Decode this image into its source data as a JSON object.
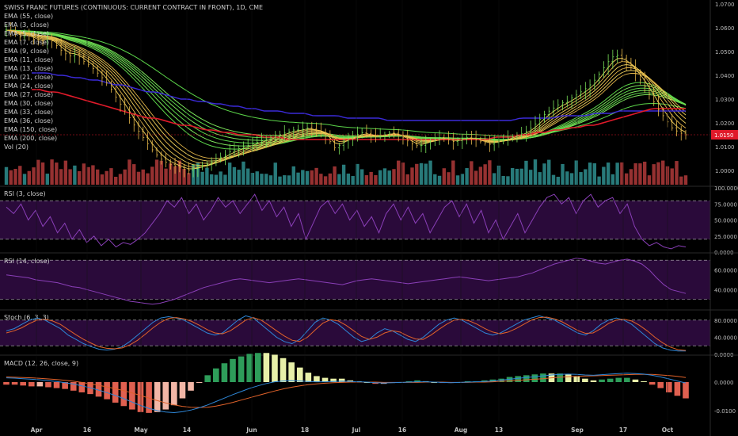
{
  "title": "SWISS FRANC FUTURES (CONTINUOUS: CURRENT CONTRACT IN FRONT), 1D, CME",
  "legend": [
    "EMA (55, close)",
    "EMA (3, close)",
    "EMA (5, close)",
    "EMA (7, close)",
    "EMA (9, close)",
    "EMA (11, close)",
    "EMA (13, close)",
    "EMA (21, close)",
    "EMA (24, close)",
    "EMA (27, close)",
    "EMA (30, close)",
    "EMA (33, close)",
    "EMA (36, close)",
    "EMA (150, close)",
    "EMA (200, close)",
    "Vol (20)"
  ],
  "colors": {
    "background": "#000000",
    "up": "#2f8f8f",
    "down": "#b03a3a",
    "ema_short": "#f2d25c",
    "ema_mid": "#5cd64a",
    "ema150": "#e01a2a",
    "ema200": "#3b2ad8",
    "osc_band": "#2a0a3a",
    "osc_line": "#8a3fb8",
    "stoch_k": "#2e86d6",
    "stoch_d": "#e0622a",
    "macd_line": "#2e86d6",
    "signal_line": "#e0622a",
    "hist_pos": "#2e9d5a",
    "hist_neg": "#e06050",
    "hist_pale": "#e8f0a8"
  },
  "price_axis": [
    "1.0700",
    "1.0600",
    "1.0500",
    "1.0400",
    "1.0300",
    "1.0200",
    "1.0100",
    "1.0000"
  ],
  "last_price": "1.0150",
  "x_axis": [
    "Apr",
    "16",
    "May",
    "14",
    "Jun",
    "18",
    "Jul",
    "16",
    "Aug",
    "13",
    "Sep",
    "17",
    "Oct"
  ],
  "panels": {
    "rsi3": {
      "label": "RSI (3, close)",
      "axis": [
        "100.0000",
        "75.0000",
        "50.0000",
        "25.0000",
        "0.0000"
      ]
    },
    "rsi14": {
      "label": "RSI (14, close)",
      "axis": [
        "60.0000",
        "40.0000"
      ]
    },
    "stoch": {
      "label": "Stoch (6, 3, 3)",
      "axis": [
        "80.0000",
        "40.0000",
        "0.0000"
      ]
    },
    "macd": {
      "label": "MACD (12, 26, close, 9)",
      "axis": [
        "0.0000",
        "-0.0100"
      ]
    }
  },
  "chart_data": {
    "type": "line",
    "price_close": [
      1.059,
      1.058,
      1.056,
      1.057,
      1.055,
      1.054,
      1.056,
      1.053,
      1.05,
      1.048,
      1.049,
      1.046,
      1.044,
      1.041,
      1.038,
      1.034,
      1.029,
      1.025,
      1.02,
      1.016,
      1.012,
      1.008,
      1.005,
      1.003,
      1.002,
      1.001,
      1.0,
      1.001,
      1.002,
      1.003,
      1.005,
      1.006,
      1.008,
      1.009,
      1.01,
      1.011,
      1.012,
      1.013,
      1.014,
      1.015,
      1.016,
      1.017,
      1.017,
      1.018,
      1.017,
      1.016,
      1.013,
      1.009,
      1.012,
      1.014,
      1.015,
      1.016,
      1.015,
      1.014,
      1.015,
      1.016,
      1.015,
      1.013,
      1.011,
      1.01,
      1.012,
      1.013,
      1.014,
      1.013,
      1.012,
      1.013,
      1.014,
      1.013,
      1.012,
      1.011,
      1.012,
      1.013,
      1.014,
      1.015,
      1.016,
      1.018,
      1.021,
      1.024,
      1.026,
      1.028,
      1.029,
      1.031,
      1.033,
      1.035,
      1.038,
      1.042,
      1.046,
      1.049,
      1.047,
      1.044,
      1.04,
      1.036,
      1.031,
      1.026,
      1.022,
      1.018,
      1.016,
      1.015
    ],
    "ema150": [
      1.034,
      1.034,
      1.033,
      1.033,
      1.032,
      1.031,
      1.03,
      1.029,
      1.028,
      1.027,
      1.026,
      1.025,
      1.024,
      1.023,
      1.022,
      1.022,
      1.021,
      1.02,
      1.019,
      1.019,
      1.018,
      1.017,
      1.017,
      1.016,
      1.016,
      1.015,
      1.015,
      1.015,
      1.014,
      1.014,
      1.014,
      1.013,
      1.013,
      1.013,
      1.013,
      1.013,
      1.013,
      1.013,
      1.013,
      1.013,
      1.013,
      1.013,
      1.013,
      1.013,
      1.013,
      1.013,
      1.013,
      1.013,
      1.013,
      1.013,
      1.013,
      1.013,
      1.013,
      1.013,
      1.013,
      1.013,
      1.014,
      1.014,
      1.014,
      1.015,
      1.015,
      1.016,
      1.016,
      1.017,
      1.017,
      1.018,
      1.018,
      1.019,
      1.019,
      1.02,
      1.021,
      1.022,
      1.023,
      1.024,
      1.025,
      1.026,
      1.026,
      1.026,
      1.026,
      1.026
    ],
    "ema200": [
      1.041,
      1.041,
      1.041,
      1.04,
      1.04,
      1.039,
      1.039,
      1.038,
      1.038,
      1.037,
      1.036,
      1.036,
      1.035,
      1.034,
      1.033,
      1.033,
      1.032,
      1.031,
      1.03,
      1.03,
      1.029,
      1.029,
      1.028,
      1.028,
      1.027,
      1.027,
      1.026,
      1.026,
      1.025,
      1.025,
      1.025,
      1.024,
      1.024,
      1.024,
      1.023,
      1.023,
      1.023,
      1.023,
      1.022,
      1.022,
      1.022,
      1.022,
      1.022,
      1.021,
      1.021,
      1.021,
      1.021,
      1.021,
      1.021,
      1.021,
      1.021,
      1.021,
      1.021,
      1.021,
      1.021,
      1.021,
      1.021,
      1.021,
      1.021,
      1.022,
      1.022,
      1.022,
      1.022,
      1.022,
      1.023,
      1.023,
      1.023,
      1.023,
      1.024,
      1.024,
      1.024,
      1.025,
      1.025,
      1.025,
      1.025,
      1.025,
      1.025,
      1.025,
      1.025,
      1.025
    ],
    "rsi3": [
      70,
      60,
      75,
      50,
      65,
      40,
      55,
      30,
      45,
      20,
      35,
      15,
      25,
      10,
      20,
      8,
      15,
      12,
      20,
      30,
      45,
      60,
      80,
      70,
      85,
      60,
      75,
      50,
      65,
      85,
      70,
      80,
      60,
      75,
      90,
      65,
      80,
      55,
      70,
      40,
      60,
      20,
      45,
      70,
      80,
      60,
      75,
      50,
      65,
      40,
      55,
      30,
      60,
      75,
      50,
      70,
      45,
      60,
      30,
      50,
      70,
      80,
      55,
      75,
      45,
      65,
      30,
      50,
      20,
      40,
      60,
      30,
      50,
      70,
      85,
      90,
      75,
      85,
      60,
      80,
      90,
      70,
      80,
      85,
      60,
      75,
      40,
      20,
      10,
      15,
      8,
      5,
      10,
      8
    ],
    "rsi14": [
      55,
      54,
      53,
      52,
      50,
      49,
      48,
      47,
      45,
      43,
      42,
      40,
      38,
      36,
      34,
      32,
      30,
      28,
      27,
      26,
      25,
      26,
      28,
      30,
      33,
      36,
      39,
      42,
      44,
      46,
      48,
      50,
      51,
      50,
      49,
      48,
      47,
      48,
      49,
      50,
      51,
      50,
      49,
      48,
      47,
      46,
      45,
      47,
      49,
      50,
      51,
      50,
      49,
      48,
      47,
      46,
      47,
      48,
      49,
      50,
      51,
      52,
      53,
      52,
      51,
      50,
      49,
      50,
      51,
      52,
      53,
      55,
      57,
      60,
      63,
      66,
      68,
      70,
      72,
      71,
      69,
      67,
      66,
      68,
      70,
      71,
      69,
      66,
      60,
      52,
      45,
      40,
      38,
      36
    ],
    "stoch_k": [
      55,
      60,
      70,
      80,
      85,
      80,
      70,
      60,
      45,
      35,
      25,
      18,
      12,
      10,
      12,
      18,
      30,
      45,
      60,
      75,
      85,
      88,
      85,
      80,
      70,
      60,
      50,
      45,
      50,
      65,
      80,
      90,
      85,
      70,
      55,
      40,
      30,
      25,
      35,
      55,
      75,
      85,
      80,
      70,
      55,
      40,
      30,
      35,
      50,
      60,
      55,
      45,
      35,
      30,
      40,
      55,
      70,
      80,
      85,
      80,
      70,
      60,
      50,
      45,
      50,
      60,
      70,
      80,
      85,
      90,
      85,
      80,
      70,
      60,
      50,
      45,
      55,
      70,
      80,
      85,
      80,
      70,
      55,
      40,
      25,
      15,
      10,
      8,
      8
    ],
    "stoch_d": [
      50,
      55,
      62,
      72,
      80,
      82,
      78,
      70,
      58,
      46,
      35,
      26,
      18,
      14,
      13,
      15,
      22,
      33,
      47,
      62,
      75,
      84,
      86,
      83,
      77,
      68,
      58,
      50,
      48,
      55,
      67,
      80,
      86,
      80,
      68,
      55,
      43,
      33,
      30,
      40,
      57,
      73,
      81,
      78,
      68,
      55,
      42,
      35,
      40,
      50,
      55,
      52,
      43,
      36,
      35,
      45,
      58,
      70,
      80,
      82,
      78,
      70,
      60,
      52,
      48,
      52,
      60,
      70,
      80,
      86,
      87,
      83,
      76,
      66,
      56,
      49,
      50,
      60,
      72,
      80,
      82,
      78,
      68,
      55,
      40,
      27,
      17,
      11,
      9
    ],
    "macd_line": [
      0.0015,
      0.0014,
      0.0012,
      0.001,
      0.0008,
      0.0005,
      0.0002,
      -0.0002,
      -0.0007,
      -0.0013,
      -0.002,
      -0.0028,
      -0.0037,
      -0.0047,
      -0.0058,
      -0.007,
      -0.0082,
      -0.0092,
      -0.01,
      -0.0105,
      -0.0107,
      -0.0104,
      -0.0098,
      -0.009,
      -0.008,
      -0.0068,
      -0.0056,
      -0.0044,
      -0.0033,
      -0.0022,
      -0.0013,
      -0.0005,
      0.0001,
      0.0004,
      0.0005,
      0.0004,
      0.0002,
      0.0001,
      0.0001,
      0.0002,
      0.0003,
      0.0002,
      0.0001,
      0.0,
      -0.0002,
      -0.0003,
      -0.0002,
      -0.0001,
      0.0,
      0.0001,
      0.0001,
      0.0,
      -0.0001,
      -0.0002,
      -0.0001,
      0.0,
      0.0001,
      0.0002,
      0.0004,
      0.0007,
      0.001,
      0.0013,
      0.0016,
      0.0019,
      0.0022,
      0.0025,
      0.0027,
      0.0028,
      0.0027,
      0.0025,
      0.0024,
      0.0026,
      0.0028,
      0.003,
      0.0031,
      0.003,
      0.0028,
      0.0024,
      0.0018,
      0.0011,
      0.0004,
      -0.0003
    ],
    "signal_line": [
      0.0018,
      0.0017,
      0.0016,
      0.0015,
      0.0013,
      0.0011,
      0.0009,
      0.0006,
      0.0003,
      -0.0001,
      -0.0006,
      -0.0011,
      -0.0017,
      -0.0023,
      -0.003,
      -0.0038,
      -0.0047,
      -0.0056,
      -0.0065,
      -0.0073,
      -0.008,
      -0.0085,
      -0.0088,
      -0.0089,
      -0.0088,
      -0.0084,
      -0.0078,
      -0.0071,
      -0.0063,
      -0.0055,
      -0.0047,
      -0.0039,
      -0.0031,
      -0.0024,
      -0.0018,
      -0.0013,
      -0.0009,
      -0.0006,
      -0.0004,
      -0.0002,
      -0.0001,
      0.0,
      0.0,
      0.0,
      0.0,
      -0.0001,
      -0.0001,
      -0.0001,
      -0.0001,
      -0.0001,
      0.0,
      0.0,
      0.0,
      -0.0001,
      -0.0001,
      -0.0001,
      0.0,
      0.0,
      0.0001,
      0.0003,
      0.0004,
      0.0006,
      0.0008,
      0.001,
      0.0012,
      0.0015,
      0.0017,
      0.0019,
      0.002,
      0.0021,
      0.0022,
      0.0023,
      0.0024,
      0.0025,
      0.0026,
      0.0027,
      0.0027,
      0.0027,
      0.0025,
      0.0023,
      0.002,
      0.0016
    ]
  }
}
